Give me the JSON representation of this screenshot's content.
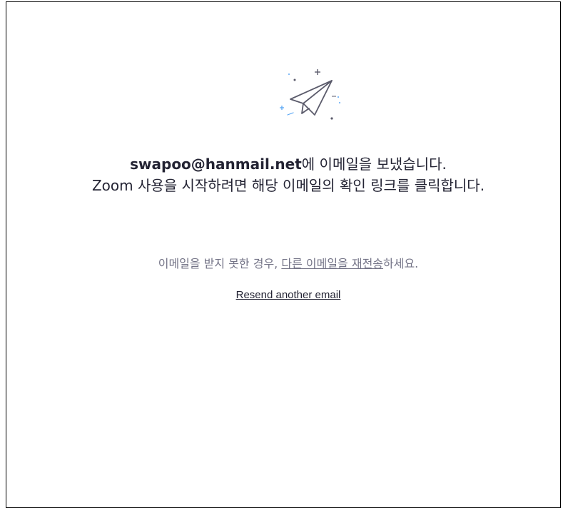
{
  "icon": {
    "name": "paper-plane-icon",
    "sparkle_color": "#5aa7f5",
    "plane_color": "#5b5b6b"
  },
  "headline": {
    "email": "swapoo@hanmail.net",
    "line1_suffix": "에 이메일을 보냈습니다.",
    "line2": "Zoom 사용을 시작하려면 해당 이메일의 확인 링크를 클릭합니다."
  },
  "notice": {
    "prefix": "이메일을 받지 못한 경우, ",
    "link": "다른 이메일을 재전송",
    "suffix": "하세요."
  },
  "resend": {
    "label": "Resend another email"
  },
  "colors": {
    "text": "#232333",
    "muted": "#747487"
  }
}
